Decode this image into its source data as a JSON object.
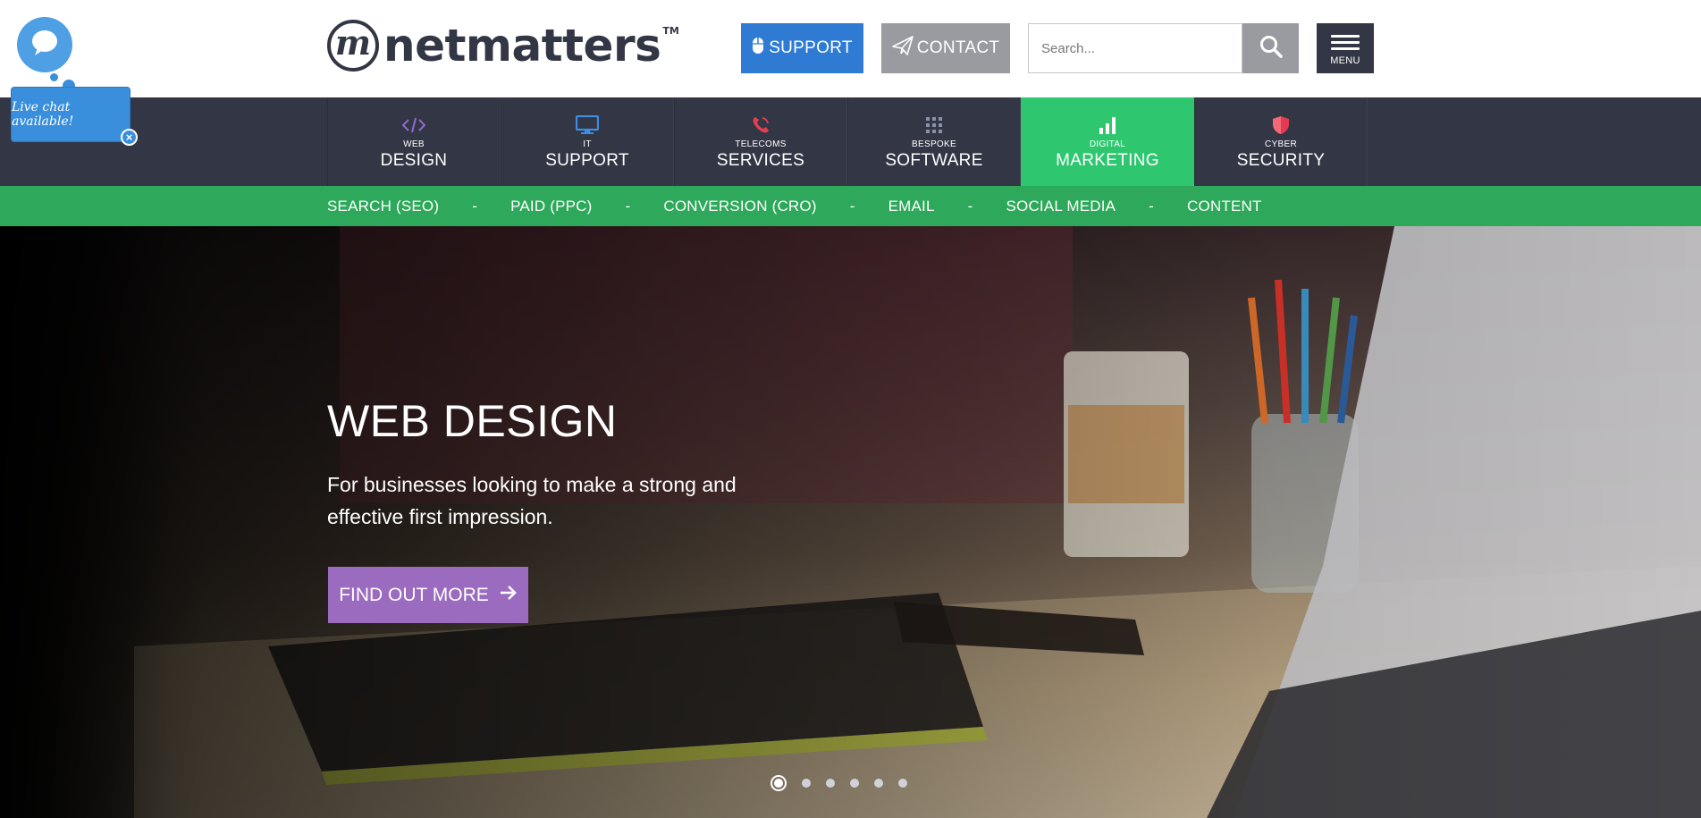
{
  "brand": {
    "name": "netmatters",
    "tm": "TM",
    "mark": "m"
  },
  "header": {
    "support_label": "SUPPORT",
    "contact_label": "CONTACT",
    "search_placeholder": "Search...",
    "menu_label": "MENU"
  },
  "nav": {
    "items": [
      {
        "small": "WEB",
        "big": "DESIGN",
        "icon": "code-icon",
        "icon_color": "#8f6bd1"
      },
      {
        "small": "IT",
        "big": "SUPPORT",
        "icon": "monitor-icon",
        "icon_color": "#3f8de3"
      },
      {
        "small": "TELECOMS",
        "big": "SERVICES",
        "icon": "phone-icon",
        "icon_color": "#e2404e"
      },
      {
        "small": "BESPOKE",
        "big": "SOFTWARE",
        "icon": "grid-icon",
        "icon_color": "#8a90a8"
      },
      {
        "small": "DIGITAL",
        "big": "MARKETING",
        "icon": "bar-chart-icon",
        "icon_color": "#ffffff",
        "active": true
      },
      {
        "small": "CYBER",
        "big": "SECURITY",
        "icon": "shield-icon",
        "icon_color": "#e23a4e"
      }
    ]
  },
  "subnav": {
    "items": [
      "SEARCH (SEO)",
      "PAID (PPC)",
      "CONVERSION (CRO)",
      "EMAIL",
      "SOCIAL MEDIA",
      "CONTENT"
    ],
    "separator": "-"
  },
  "hero": {
    "title": "WEB DESIGN",
    "text": "For businesses looking to make a strong and effective first impression.",
    "cta_label": "FIND OUT MORE",
    "slide_count": 6,
    "active_slide": 1
  },
  "chat": {
    "label": "Live chat available!",
    "close": "×"
  },
  "colors": {
    "dark": "#333645",
    "support_blue": "#2f7bd3",
    "grey_button": "#9a9ba1",
    "marketing_green": "#2ec770",
    "subnav_green": "#2ea85a",
    "cta_purple": "#9b6bbf",
    "chat_blue": "#3a8fdc"
  }
}
